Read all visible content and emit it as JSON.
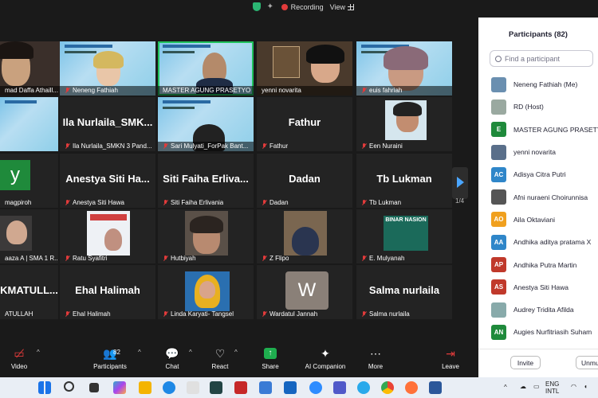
{
  "top": {
    "recording": "Recording",
    "view": "View"
  },
  "tiles": [
    {
      "name": "mad Daffa Athaill..."
    },
    {
      "name": "Neneng Fathiah"
    },
    {
      "name": "MASTER AGUNG PRASETYO"
    },
    {
      "name": "yenni novarita"
    },
    {
      "name": "euis fahriah"
    },
    {
      "big": "",
      "name": ""
    },
    {
      "big": "Ila Nurlaila_SMK...",
      "name": "Ila Nurlaila_SMKN 3 Pand..."
    },
    {
      "name": "Sari Mulyati_ForPak Bant..."
    },
    {
      "big": "Fathur",
      "name": "Fathur"
    },
    {
      "name": "Een Nuraini"
    },
    {
      "big": "",
      "name": "magpiroh",
      "letter": "y"
    },
    {
      "big": "Anestya Siti Ha...",
      "name": "Anestya Siti Hawa"
    },
    {
      "big": "Siti Faiha Erliva...",
      "name": "Siti Faiha Erlivania"
    },
    {
      "big": "Dadan",
      "name": "Dadan"
    },
    {
      "big": "Tb Lukman",
      "name": "Tb Lukman"
    },
    {
      "name": "aaza A | SMA 1 R..."
    },
    {
      "name": "Ratu Syafitri"
    },
    {
      "name": "Hutbiyah"
    },
    {
      "name": "Z Flipo"
    },
    {
      "name": "E. Mulyanah",
      "banner": "BINAR NASION"
    },
    {
      "big": "KMATULL...",
      "name": "ATULLAH"
    },
    {
      "big": "Ehal Halimah",
      "name": "Ehal Halimah"
    },
    {
      "name": "Linda Karyati- Tangsel"
    },
    {
      "name": "Wardatul Jannah",
      "letter": "W"
    },
    {
      "big": "Salma nurlaila",
      "name": "Salma nurlaila"
    }
  ],
  "page_indicator": "1/4",
  "toolbar": {
    "video": "Video",
    "participants": "Participants",
    "participants_count": "82",
    "chat": "Chat",
    "react": "React",
    "share": "Share",
    "ai": "AI Companion",
    "more": "More",
    "leave": "Leave"
  },
  "panel": {
    "title": "Participants (82)",
    "search_placeholder": "Find a participant",
    "invite": "Invite",
    "unmute": "Unmu",
    "participants": [
      {
        "name": "Neneng Fathiah (Me)",
        "initials": "",
        "color": "#6a8fb0"
      },
      {
        "name": "RD (Host)",
        "initials": "",
        "color": "#9aa9a0"
      },
      {
        "name": "MASTER AGUNG PRASETY",
        "initials": "E",
        "color": "#1f8a3b"
      },
      {
        "name": "yenni novarita",
        "initials": "",
        "color": "#5a6f8a"
      },
      {
        "name": "Adisya Citra Putri",
        "initials": "AC",
        "color": "#2f86c9"
      },
      {
        "name": "Afni nuraeni Choirunnisa",
        "initials": "",
        "color": "#555"
      },
      {
        "name": "Aila Oktaviani",
        "initials": "AO",
        "color": "#f0a01e"
      },
      {
        "name": "Andhika aditya pratama X",
        "initials": "AA",
        "color": "#2f86c9"
      },
      {
        "name": "Andhika Putra Martin",
        "initials": "AP",
        "color": "#c0392b"
      },
      {
        "name": "Anestya Siti Hawa",
        "initials": "AS",
        "color": "#c0392b"
      },
      {
        "name": "Audrey Tridita Afilda",
        "initials": "",
        "color": "#8aa"
      },
      {
        "name": "Augies Nurfitriasih Suham",
        "initials": "AN",
        "color": "#1f8a3b"
      }
    ]
  },
  "taskbar": {
    "lang_top": "ENG",
    "lang_bottom": "INTL"
  }
}
